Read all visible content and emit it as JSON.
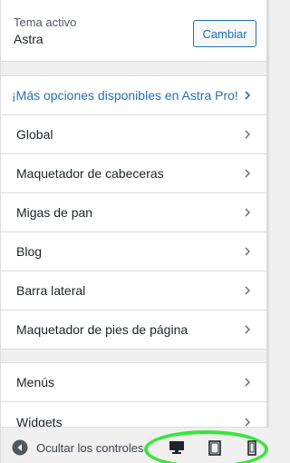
{
  "theme": {
    "caption": "Tema activo",
    "name": "Astra",
    "change_label": "Cambiar"
  },
  "promo": {
    "label": "¡Más opciones disponibles en Astra Pro!"
  },
  "sections_primary": [
    {
      "label": "Global"
    },
    {
      "label": "Maquetador de cabeceras"
    },
    {
      "label": "Migas de pan"
    },
    {
      "label": "Blog"
    },
    {
      "label": "Barra lateral"
    },
    {
      "label": "Maquetador de pies de página"
    }
  ],
  "sections_secondary": [
    {
      "label": "Menús"
    },
    {
      "label": "Widgets"
    }
  ],
  "footer": {
    "collapse_label": "Ocultar los controles",
    "collapse_icon": "arrow-left-circle-icon",
    "devices": [
      {
        "name": "desktop-icon",
        "selected": true
      },
      {
        "name": "tablet-icon",
        "selected": false
      },
      {
        "name": "mobile-icon",
        "selected": false
      }
    ]
  },
  "colors": {
    "accent": "#2271b1",
    "highlight": "#39e639",
    "text": "#1d2327"
  }
}
